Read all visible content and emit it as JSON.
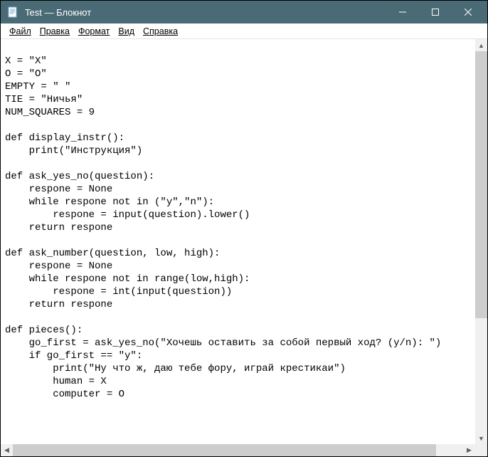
{
  "window": {
    "title": "Test — Блокнот"
  },
  "menu": {
    "file": "Файл",
    "edit": "Правка",
    "format": "Формат",
    "view": "Вид",
    "help": "Справка"
  },
  "editor": {
    "content": "\nX = \"X\"\nO = \"O\"\nEMPTY = \" \"\nTIE = \"Ничья\"\nNUM_SQUARES = 9\n\ndef display_instr():\n    print(\"Инструкция\")\n\ndef ask_yes_no(question):\n    respone = None\n    while respone not in (\"y\",\"n\"):\n        respone = input(question).lower()\n    return respone\n\ndef ask_number(question, low, high):\n    respone = None\n    while respone not in range(low,high):\n        respone = int(input(question))\n    return respone\n\ndef pieces():\n    go_first = ask_yes_no(\"Хочешь оставить за собой первый ход? (y/n): \")\n    if go_first == \"y\":\n        print(\"Ну что ж, даю тебе фору, играй крестикаи\")\n        human = X\n        computer = O"
  }
}
